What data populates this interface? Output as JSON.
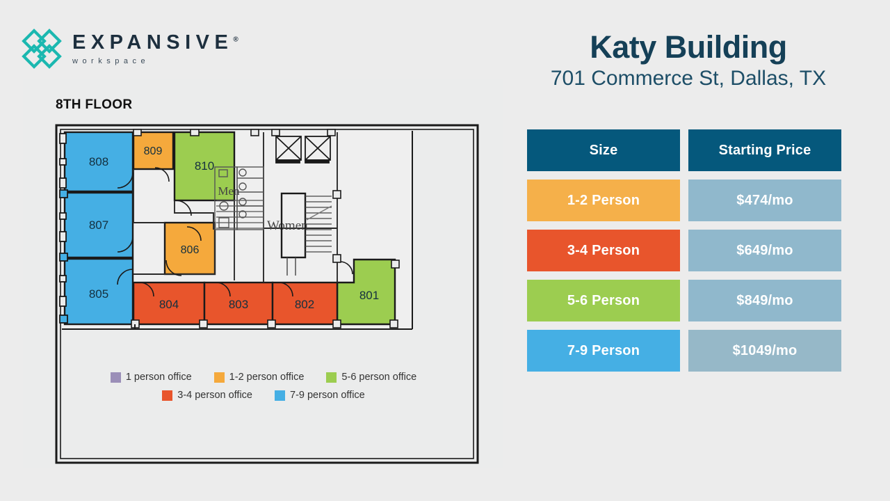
{
  "logo": {
    "icon": "expansive-lattice-icon",
    "wordmark": "EXPANSIVE",
    "registered": "®",
    "tagline": "workspace",
    "color": "#1bb8b0"
  },
  "header": {
    "title": "Katy Building",
    "address": "701 Commerce St, Dallas, TX",
    "title_color": "#154057"
  },
  "floorplan": {
    "floor_label": "8TH FLOOR",
    "rooms": [
      {
        "id": "808",
        "label": "808",
        "category": "7-9 person office",
        "color": "#45afe4"
      },
      {
        "id": "807",
        "label": "807",
        "category": "7-9 person office",
        "color": "#45afe4"
      },
      {
        "id": "805",
        "label": "805",
        "category": "7-9 person office",
        "color": "#45afe4"
      },
      {
        "id": "809",
        "label": "809",
        "category": "1-2 person office",
        "color": "#f5a93c"
      },
      {
        "id": "806",
        "label": "806",
        "category": "1-2 person office",
        "color": "#f5a93c"
      },
      {
        "id": "810",
        "label": "810",
        "category": "5-6 person office",
        "color": "#9ccd50"
      },
      {
        "id": "801",
        "label": "801",
        "category": "5-6 person office",
        "color": "#9ccd50"
      },
      {
        "id": "804",
        "label": "804",
        "category": "3-4 person office",
        "color": "#e8552c"
      },
      {
        "id": "803",
        "label": "803",
        "category": "3-4 person office",
        "color": "#e8552c"
      },
      {
        "id": "802",
        "label": "802",
        "category": "3-4 person office",
        "color": "#e8552c"
      }
    ],
    "core_labels": [
      {
        "name": "mens-restroom",
        "label": "Men"
      },
      {
        "name": "womens-restroom",
        "label": "Women"
      }
    ]
  },
  "legend": {
    "row1": [
      {
        "label": "1 person office",
        "color": "#9b8fb8"
      },
      {
        "label": "1-2 person office",
        "color": "#f5a93c"
      },
      {
        "label": "5-6 person office",
        "color": "#9ccd50"
      }
    ],
    "row2": [
      {
        "label": "3-4 person office",
        "color": "#e8552c"
      },
      {
        "label": "7-9 person office",
        "color": "#45afe4"
      }
    ]
  },
  "price_table": {
    "header": {
      "size": "Size",
      "price": "Starting Price",
      "bg": "#05587c"
    },
    "price_bg": "#90b8cc",
    "rows": [
      {
        "size": "1-2 Person",
        "price": "$474/mo",
        "size_bg": "#f5b04a"
      },
      {
        "size": "3-4 Person",
        "price": "$649/mo",
        "size_bg": "#e8552c"
      },
      {
        "size": "5-6 Person",
        "price": "$849/mo",
        "size_bg": "#9ccd50"
      },
      {
        "size": "7-9 Person",
        "price": "$1049/mo",
        "size_bg": "#45afe4"
      }
    ]
  }
}
